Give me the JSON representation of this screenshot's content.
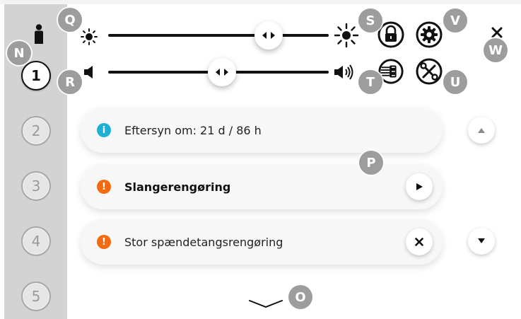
{
  "sidebar": {
    "steps": [
      {
        "label": "1",
        "active": true
      },
      {
        "label": "2",
        "active": false
      },
      {
        "label": "3",
        "active": false
      },
      {
        "label": "4",
        "active": false
      },
      {
        "label": "5",
        "active": false
      }
    ]
  },
  "controls": {
    "brightness_slider": {
      "level_fraction": 0.68
    },
    "volume_slider": {
      "level_fraction": 0.54
    }
  },
  "notifications": [
    {
      "icon": "info-icon",
      "text": "Eftersyn om: 21 d / 86 h",
      "bold": false,
      "color": "#1fb0d6"
    },
    {
      "icon": "alert-icon",
      "text": "Slangerengøring",
      "bold": true,
      "color": "#f26b12",
      "action": "play-icon"
    },
    {
      "icon": "alert-icon",
      "text": "Stor spændetangsrengøring",
      "bold": false,
      "color": "#f26b12",
      "action": "close-icon"
    }
  ],
  "markers": {
    "n": "N",
    "o": "O",
    "p": "P",
    "q": "Q",
    "r": "R",
    "s": "S",
    "t": "T",
    "u": "U",
    "v": "V",
    "w": "W"
  },
  "colors": {
    "sidebar": "#d3d3d3",
    "marker": "#9d9d9d",
    "info": "#1fb0d6",
    "warning": "#f26b12"
  }
}
